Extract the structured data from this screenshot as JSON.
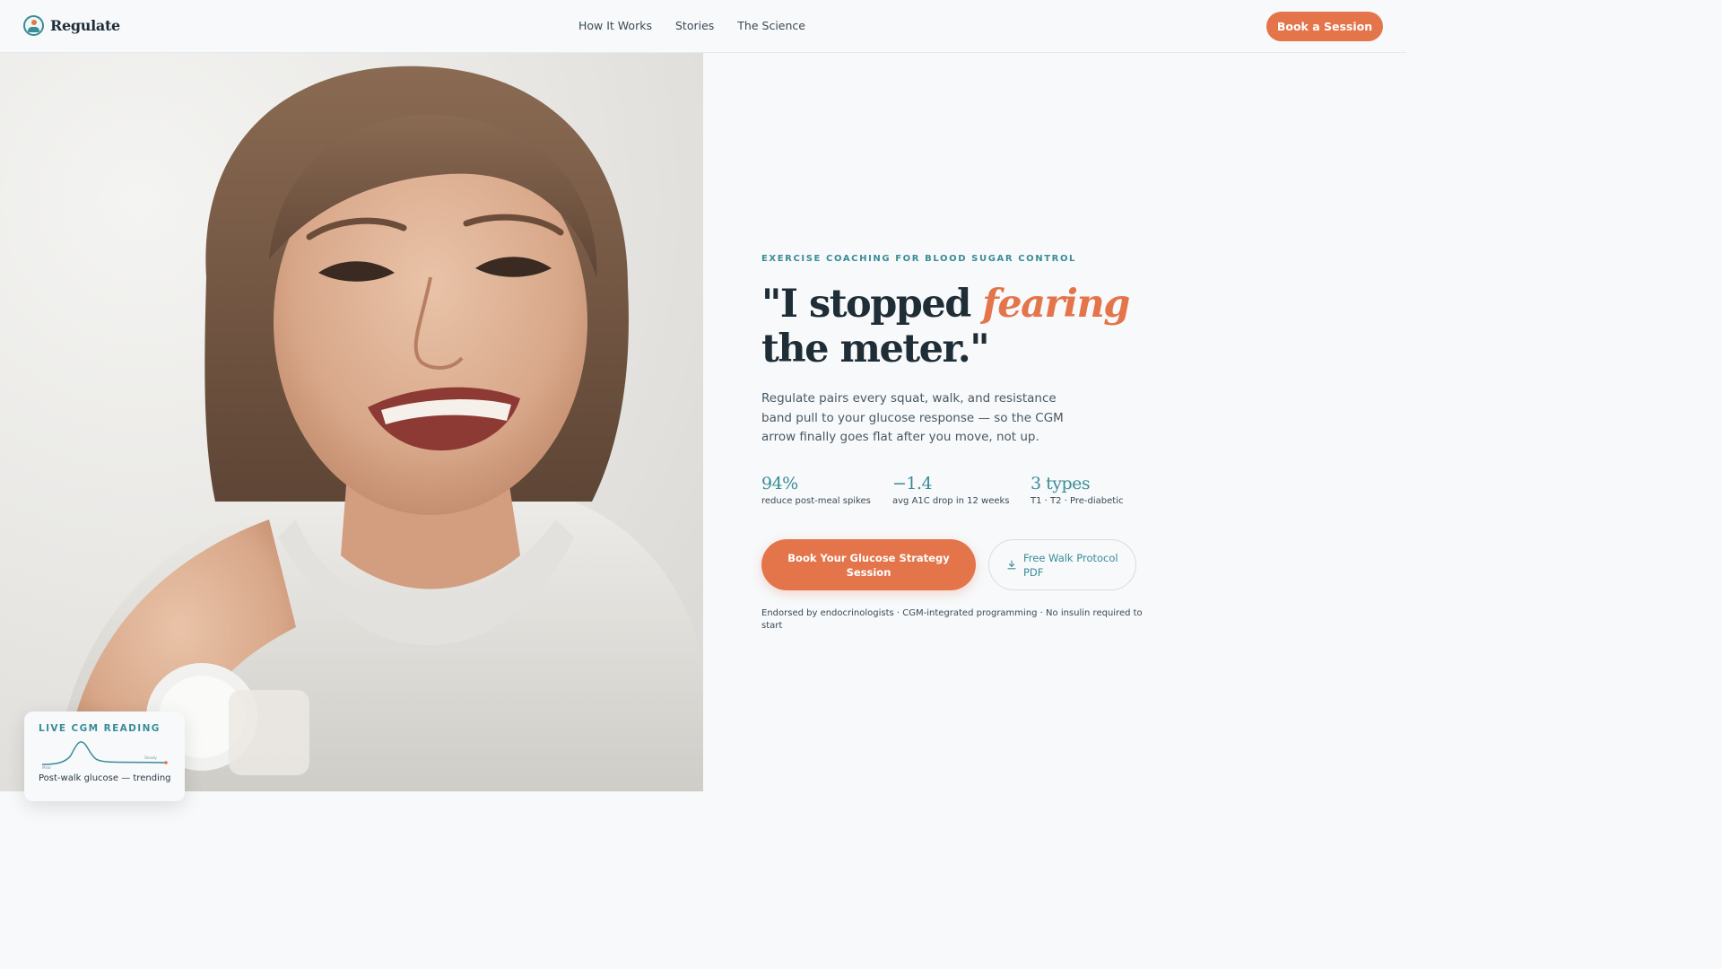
{
  "nav": {
    "brand": "Regulate",
    "links": [
      "How It Works",
      "Stories",
      "The Science"
    ],
    "cta": "Book a Session"
  },
  "hero": {
    "eyebrow": "EXERCISE COACHING FOR BLOOD SUGAR CONTROL",
    "headline_prefix": "\"I stopped ",
    "headline_emphasis": "fearing",
    "headline_line2": "the meter.\"",
    "lede": "Regulate pairs every squat, walk, and resistance band pull to your glucose response — so the CGM arrow finally goes flat after you move, not up.",
    "stats": [
      {
        "value": "94%",
        "label": "reduce post-meal spikes"
      },
      {
        "value": "−1.4",
        "label": "avg A1C drop in 12 weeks"
      },
      {
        "value": "3 types",
        "label": "T1 · T2 · Pre-diabetic"
      }
    ],
    "primary_cta": "Book Your Glucose Strategy Session",
    "secondary_cta": "Free Walk Protocol PDF",
    "endorsement": "Endorsed by endocrinologists · CGM-integrated programming · No insulin required to start"
  },
  "cgm_card": {
    "title": "LIVE CGM READING",
    "caption": "Post-walk glucose — trending",
    "chart_start_label": "Meal",
    "chart_end_label": "Steady"
  },
  "colors": {
    "accent": "#e4744a",
    "teal": "#3a8d96",
    "ink": "#1f2d36",
    "background": "#f7f9fb"
  },
  "icons": {
    "brand": "logo-mark-icon",
    "download": "download-icon"
  }
}
